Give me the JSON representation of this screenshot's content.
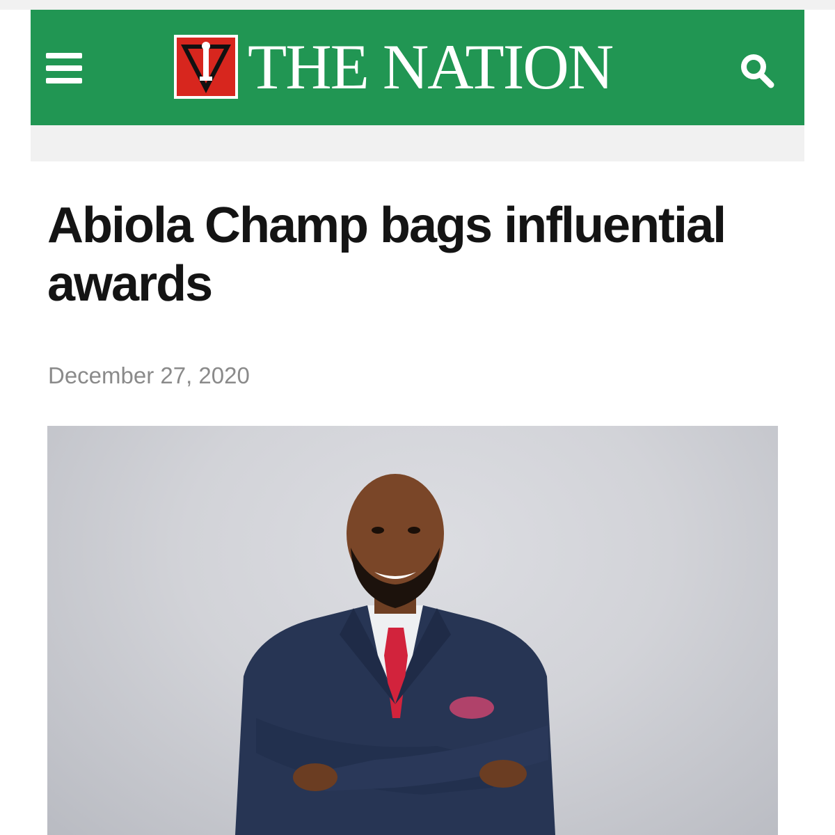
{
  "header": {
    "brand_name": "THE NATION",
    "logo_icon": "torch-emblem-icon",
    "menu_icon": "hamburger-menu-icon",
    "search_icon": "search-icon"
  },
  "article": {
    "title": "Abiola Champ bags influential awards",
    "date": "December 27, 2020"
  },
  "colors": {
    "brand_green": "#219653",
    "emblem_red": "#d7261e",
    "headline_text": "#141414",
    "date_text": "#8a8a8a"
  }
}
